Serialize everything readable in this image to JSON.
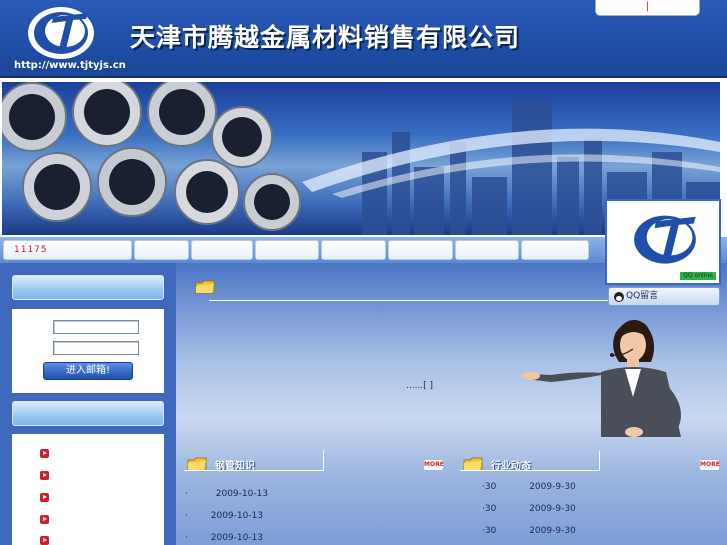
{
  "header": {
    "company_name": "天津市腾越金属材料销售有限公司",
    "site_url": "http://www.tjtyjs.cn",
    "top_link": "|"
  },
  "nav": {
    "first_item": "11175"
  },
  "login": {
    "button_label": "进入邮箱!"
  },
  "intro": {
    "text": "......[ ]"
  },
  "sections": {
    "steel_knowledge": {
      "title": "钢管知识",
      "badge": "MORE",
      "rows": [
        {
          "bullet": "·",
          "date": "2009-10-13"
        },
        {
          "bullet": "·",
          "date": "2009-10-13"
        },
        {
          "bullet": "·",
          "date": "2009-10-13"
        }
      ]
    },
    "industry_news": {
      "title": "行业动态",
      "badge": "MORE",
      "rows": [
        {
          "bullet": "·30",
          "date": "2009-9-30"
        },
        {
          "bullet": "·30",
          "date": "2009-9-30"
        },
        {
          "bullet": "·30",
          "date": "2009-9-30"
        }
      ]
    }
  },
  "qq": {
    "online_label": "QQ online",
    "message_label": "QQ留言"
  },
  "colors": {
    "header_blue": "#1f4fa8",
    "accent_red": "#d0202a",
    "online_green": "#2bb34a"
  },
  "icons": [
    "logo-icon",
    "folder-icon",
    "bullet-arrow-icon",
    "qq-penguin-icon"
  ]
}
